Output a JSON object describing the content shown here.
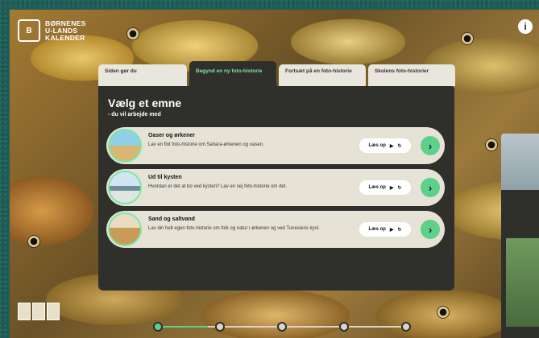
{
  "logo": {
    "mark": "B",
    "line1": "BØRNENES",
    "line2": "U-LANDS",
    "line3": "KALENDER"
  },
  "header": {
    "info_label": "i"
  },
  "tabs": [
    {
      "label": "Siden gør du"
    },
    {
      "label": "Begynd en ny foto-historie"
    },
    {
      "label": "Fortsæt på en foto-historie"
    },
    {
      "label": "Skolens foto-historier"
    }
  ],
  "panel": {
    "title": "Vælg et emne",
    "subtitle": "- du vil arbejde med",
    "topics": [
      {
        "name": "Oaser og ørkener",
        "desc": "Lav en flot foto-historie om Sahara-ørkenen og oasen.",
        "read_label": "Læs op"
      },
      {
        "name": "Ud til kysten",
        "desc": "Hvordan er det at bo ved kysten? Lav en sej foto-historie om det.",
        "read_label": "Læs op"
      },
      {
        "name": "Sand og saltvand",
        "desc": "Lav din helt egen foto-historie om folk og natur i ørkenen og ved Tunesiens kyst.",
        "read_label": "Læs op"
      }
    ]
  },
  "progress": {
    "value": 0.2,
    "steps": 5
  },
  "colors": {
    "accent": "#5fd08a",
    "panel": "#2f2f2b",
    "card": "#e6e3d6",
    "frame": "#1e5f59"
  }
}
